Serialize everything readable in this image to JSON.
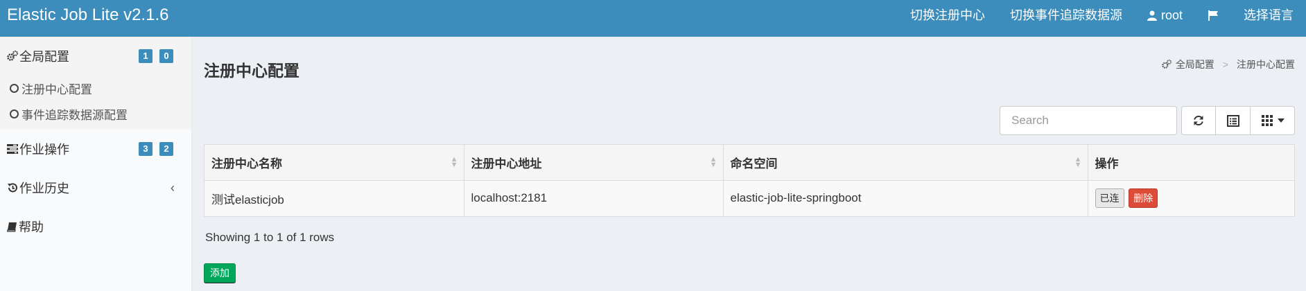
{
  "header": {
    "title": "Elastic Job Lite v2.1.6",
    "nav": {
      "switch_registry": "切换注册中心",
      "switch_event_source": "切换事件追踪数据源",
      "user": "root",
      "language": "选择语言"
    }
  },
  "sidebar": {
    "global_config": {
      "label": "全局配置",
      "badges": [
        "1",
        "0"
      ]
    },
    "global_sub": [
      "注册中心配置",
      "事件追踪数据源配置"
    ],
    "job_ops": {
      "label": "作业操作",
      "badges": [
        "3",
        "2"
      ]
    },
    "job_history": {
      "label": "作业历史",
      "chevron": "‹"
    },
    "help": {
      "label": "帮助"
    }
  },
  "main": {
    "title": "注册中心配置",
    "breadcrumb": {
      "root": "全局配置",
      "sep": ">",
      "current": "注册中心配置"
    },
    "search": {
      "placeholder": "Search"
    },
    "table": {
      "headers": [
        "注册中心名称",
        "注册中心地址",
        "命名空间",
        "操作"
      ],
      "rows": [
        {
          "name": "测试elasticjob",
          "address": "localhost:2181",
          "namespace": "elastic-job-lite-springboot",
          "connected_label": "已连",
          "delete_label": "删除"
        }
      ]
    },
    "rows_info": "Showing 1 to 1 of 1 rows",
    "add_label": "添加"
  },
  "colors": {
    "header": "#3c8dbc",
    "badge": "#3c8dbc",
    "delete": "#dd4b39",
    "add": "#00a65a"
  }
}
